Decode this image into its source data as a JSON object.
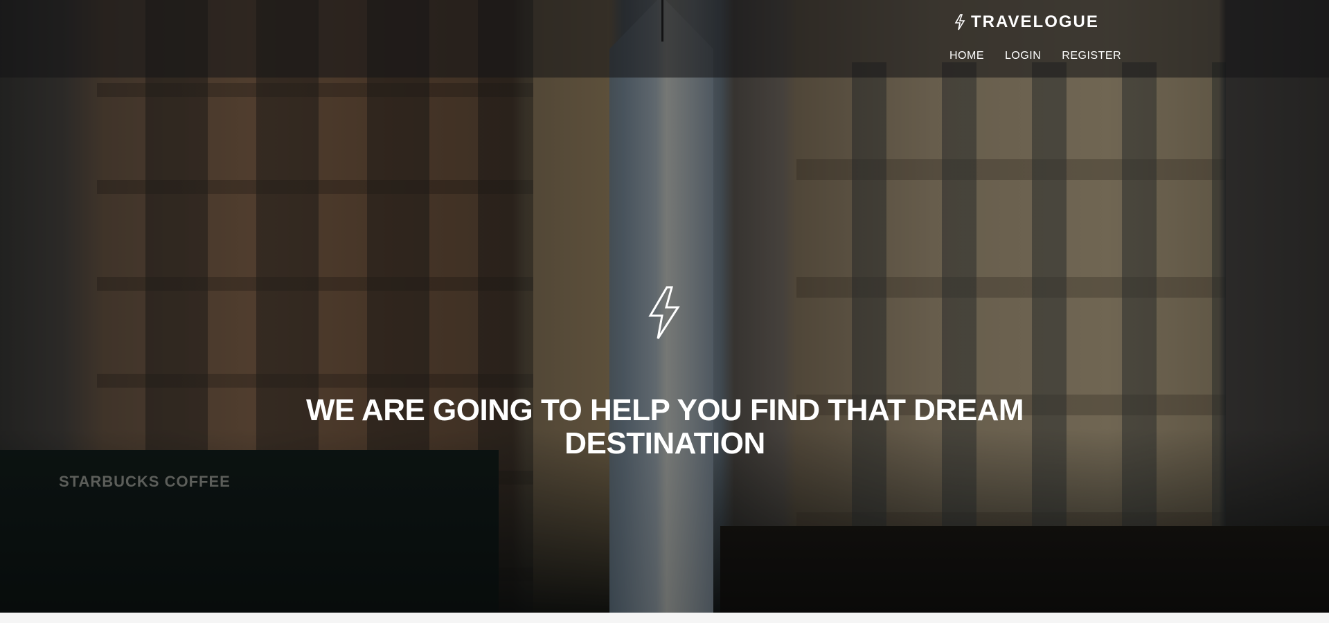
{
  "header": {
    "brand": {
      "icon": "lightning-bolt-icon",
      "name": "TRAVELOGUE"
    },
    "nav": [
      {
        "label": "HOME"
      },
      {
        "label": "LOGIN"
      },
      {
        "label": "REGISTER"
      }
    ]
  },
  "hero": {
    "icon": "lightning-bolt-icon",
    "title": "WE ARE GOING TO HELP YOU FIND THAT DREAM DESTINATION",
    "background_image": {
      "signage": [
        "STARBUCKS COFFEE"
      ]
    }
  },
  "colors": {
    "text": "#ffffff",
    "header_overlay": "rgba(20,20,22,0.55)",
    "page_background": "#f5f5f5"
  }
}
